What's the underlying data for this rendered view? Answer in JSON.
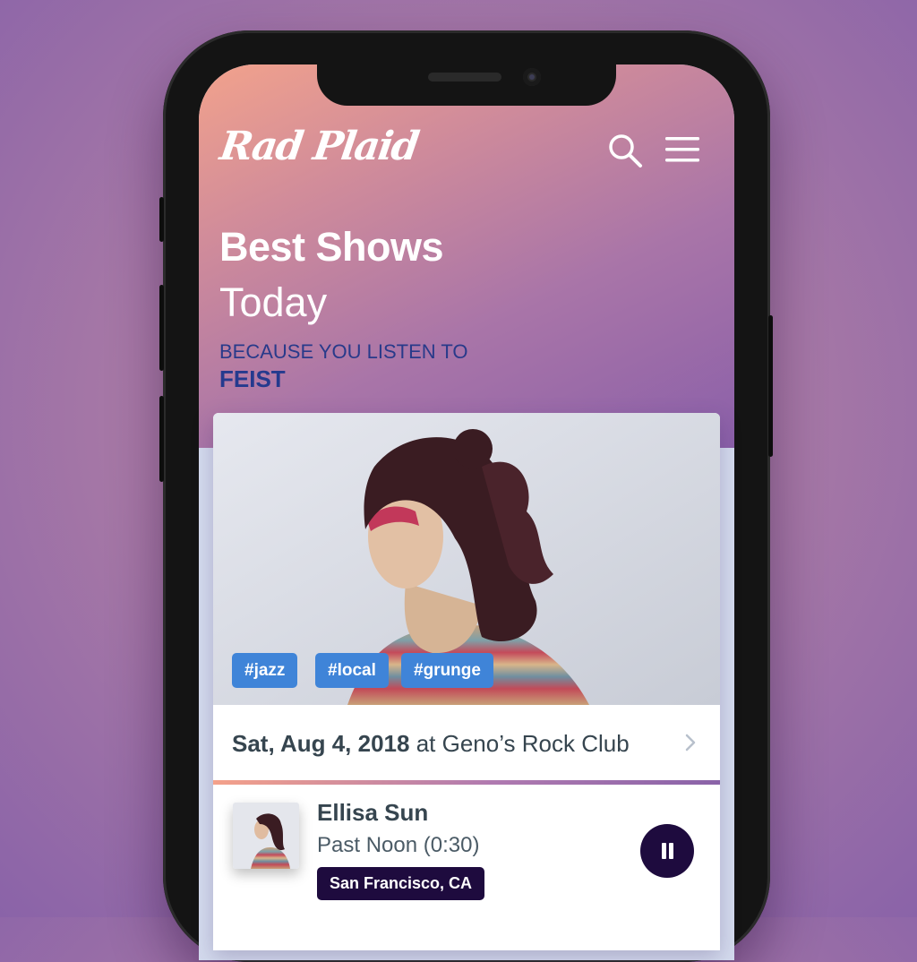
{
  "app": {
    "logo": "Rad Plaid"
  },
  "header": {
    "icons": [
      "search-icon",
      "menu-icon"
    ]
  },
  "hero": {
    "title": "Best Shows",
    "subtitle": "Today",
    "because_label": "BECAUSE YOU LISTEN TO",
    "artist": "FEIST"
  },
  "card": {
    "tags": [
      "#jazz",
      "#local",
      "#grunge"
    ],
    "event": {
      "date": "Sat, Aug 4, 2018",
      "venue": "at Geno’s Rock Club"
    },
    "track": {
      "artist": "Ellisa Sun",
      "song": "Past Noon (0:30)",
      "location": "San Francisco, CA"
    }
  },
  "colors": {
    "accent_blue": "#3f84d8",
    "dark_purple": "#1e0b3e",
    "text_blue": "#243a8e"
  }
}
